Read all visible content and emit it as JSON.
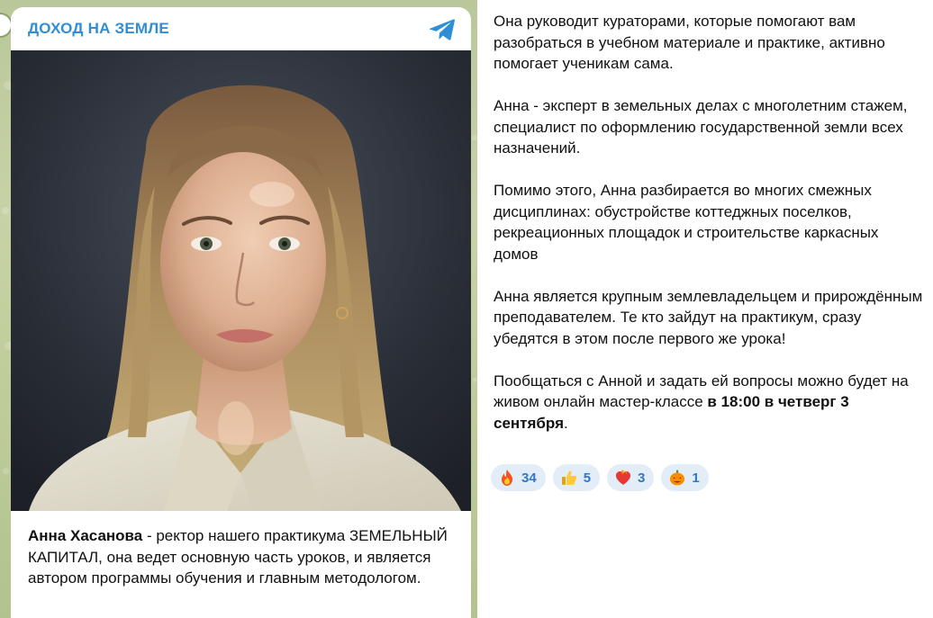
{
  "channel": {
    "name": "ДОХОД НА ЗЕМЛЕ"
  },
  "caption": {
    "name": "Анна Хасанова",
    "text": " - ректор нашего практикума ЗЕМЕЛЬНЫЙ КАПИТАЛ, она ведет основную часть уроков, и является автором программы обучения и главным методологом."
  },
  "post": {
    "paragraphs": [
      "Она руководит кураторами, которые помогают вам разобраться в учебном материале и практике, активно помогает ученикам сама.",
      "Анна - эксперт в земельных делах с многолетним стажем, специалист по оформлению государственной земли всех назначений.",
      "Помимо этого, Анна разбирается во многих смежных дисциплинах: обустройстве коттеджных поселков, рекреационных площадок и строительстве каркасных домов",
      "Анна является крупным землевладельцем и прирождённым преподавателем. Те кто зайдут на практикум, сразу убедятся в этом после первого же урока!"
    ],
    "final": {
      "text": "Пообщаться с Анной и задать ей вопросы можно будет на живом онлайн мастер-классе ",
      "bold": "в 18:00 в четверг 3 сентября",
      "end": "."
    }
  },
  "reactions": [
    {
      "icon": "fire-emoji-icon",
      "count": "34"
    },
    {
      "icon": "thumbs-up-emoji-icon",
      "count": "5"
    },
    {
      "icon": "heart-on-fire-emoji-icon",
      "count": "3"
    },
    {
      "icon": "jack-o-lantern-emoji-icon",
      "count": "1"
    }
  ],
  "colors": {
    "accent": "#2f8fd6",
    "reaction_bg": "#e3edf7",
    "reaction_count": "#2f78c4"
  }
}
